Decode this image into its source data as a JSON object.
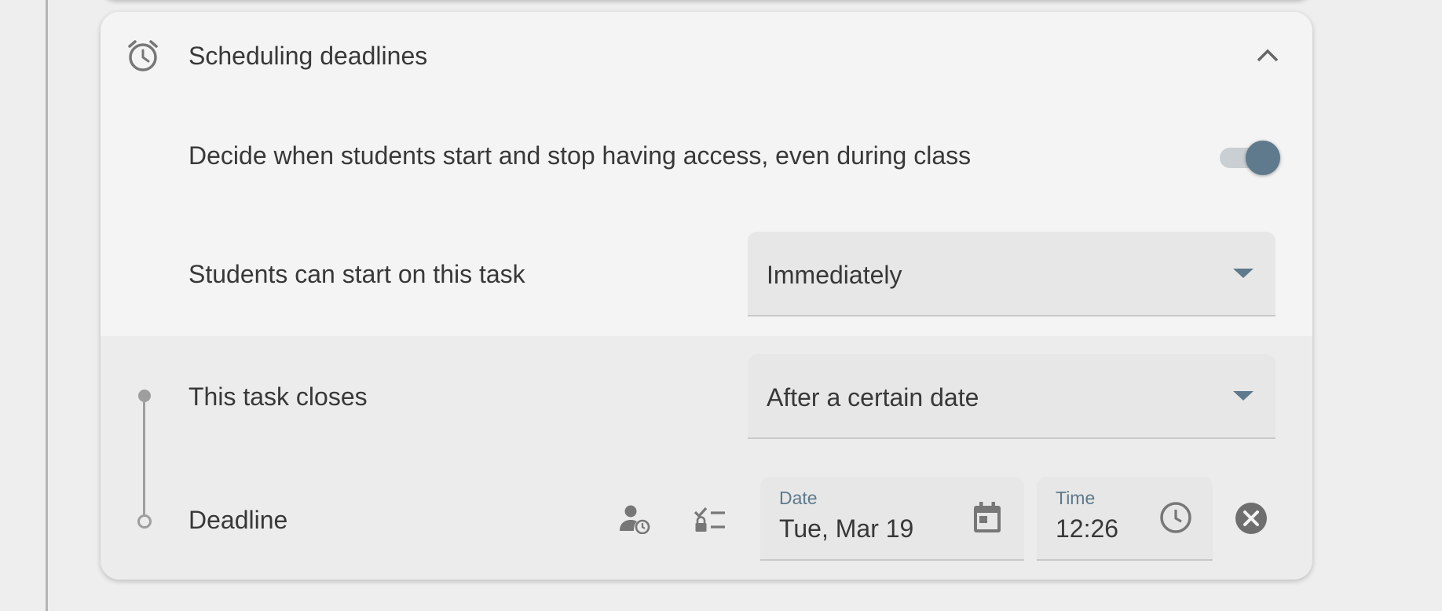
{
  "section": {
    "title": "Scheduling deadlines",
    "icon": "alarm-clock-icon",
    "collapse_icon": "chevron-up-icon"
  },
  "access_toggle": {
    "label": "Decide when students start and stop having access, even during class",
    "enabled": true,
    "color": "#5e7a8c"
  },
  "start": {
    "label": "Students can start on this task",
    "selected": "Immediately"
  },
  "close": {
    "label": "This task closes",
    "selected": "After a certain date"
  },
  "deadline": {
    "label": "Deadline",
    "date_label": "Date",
    "date_value": "Tue, Mar 19",
    "time_label": "Time",
    "time_value": "12:26",
    "icons": [
      "person-clock-icon",
      "checklist-lock-icon",
      "calendar-icon",
      "clock-icon",
      "clear-icon"
    ]
  },
  "colors": {
    "accent": "#5e7a8c",
    "card": "#f4f4f4",
    "card_lower": "#ececec",
    "background": "#eeeeee"
  }
}
